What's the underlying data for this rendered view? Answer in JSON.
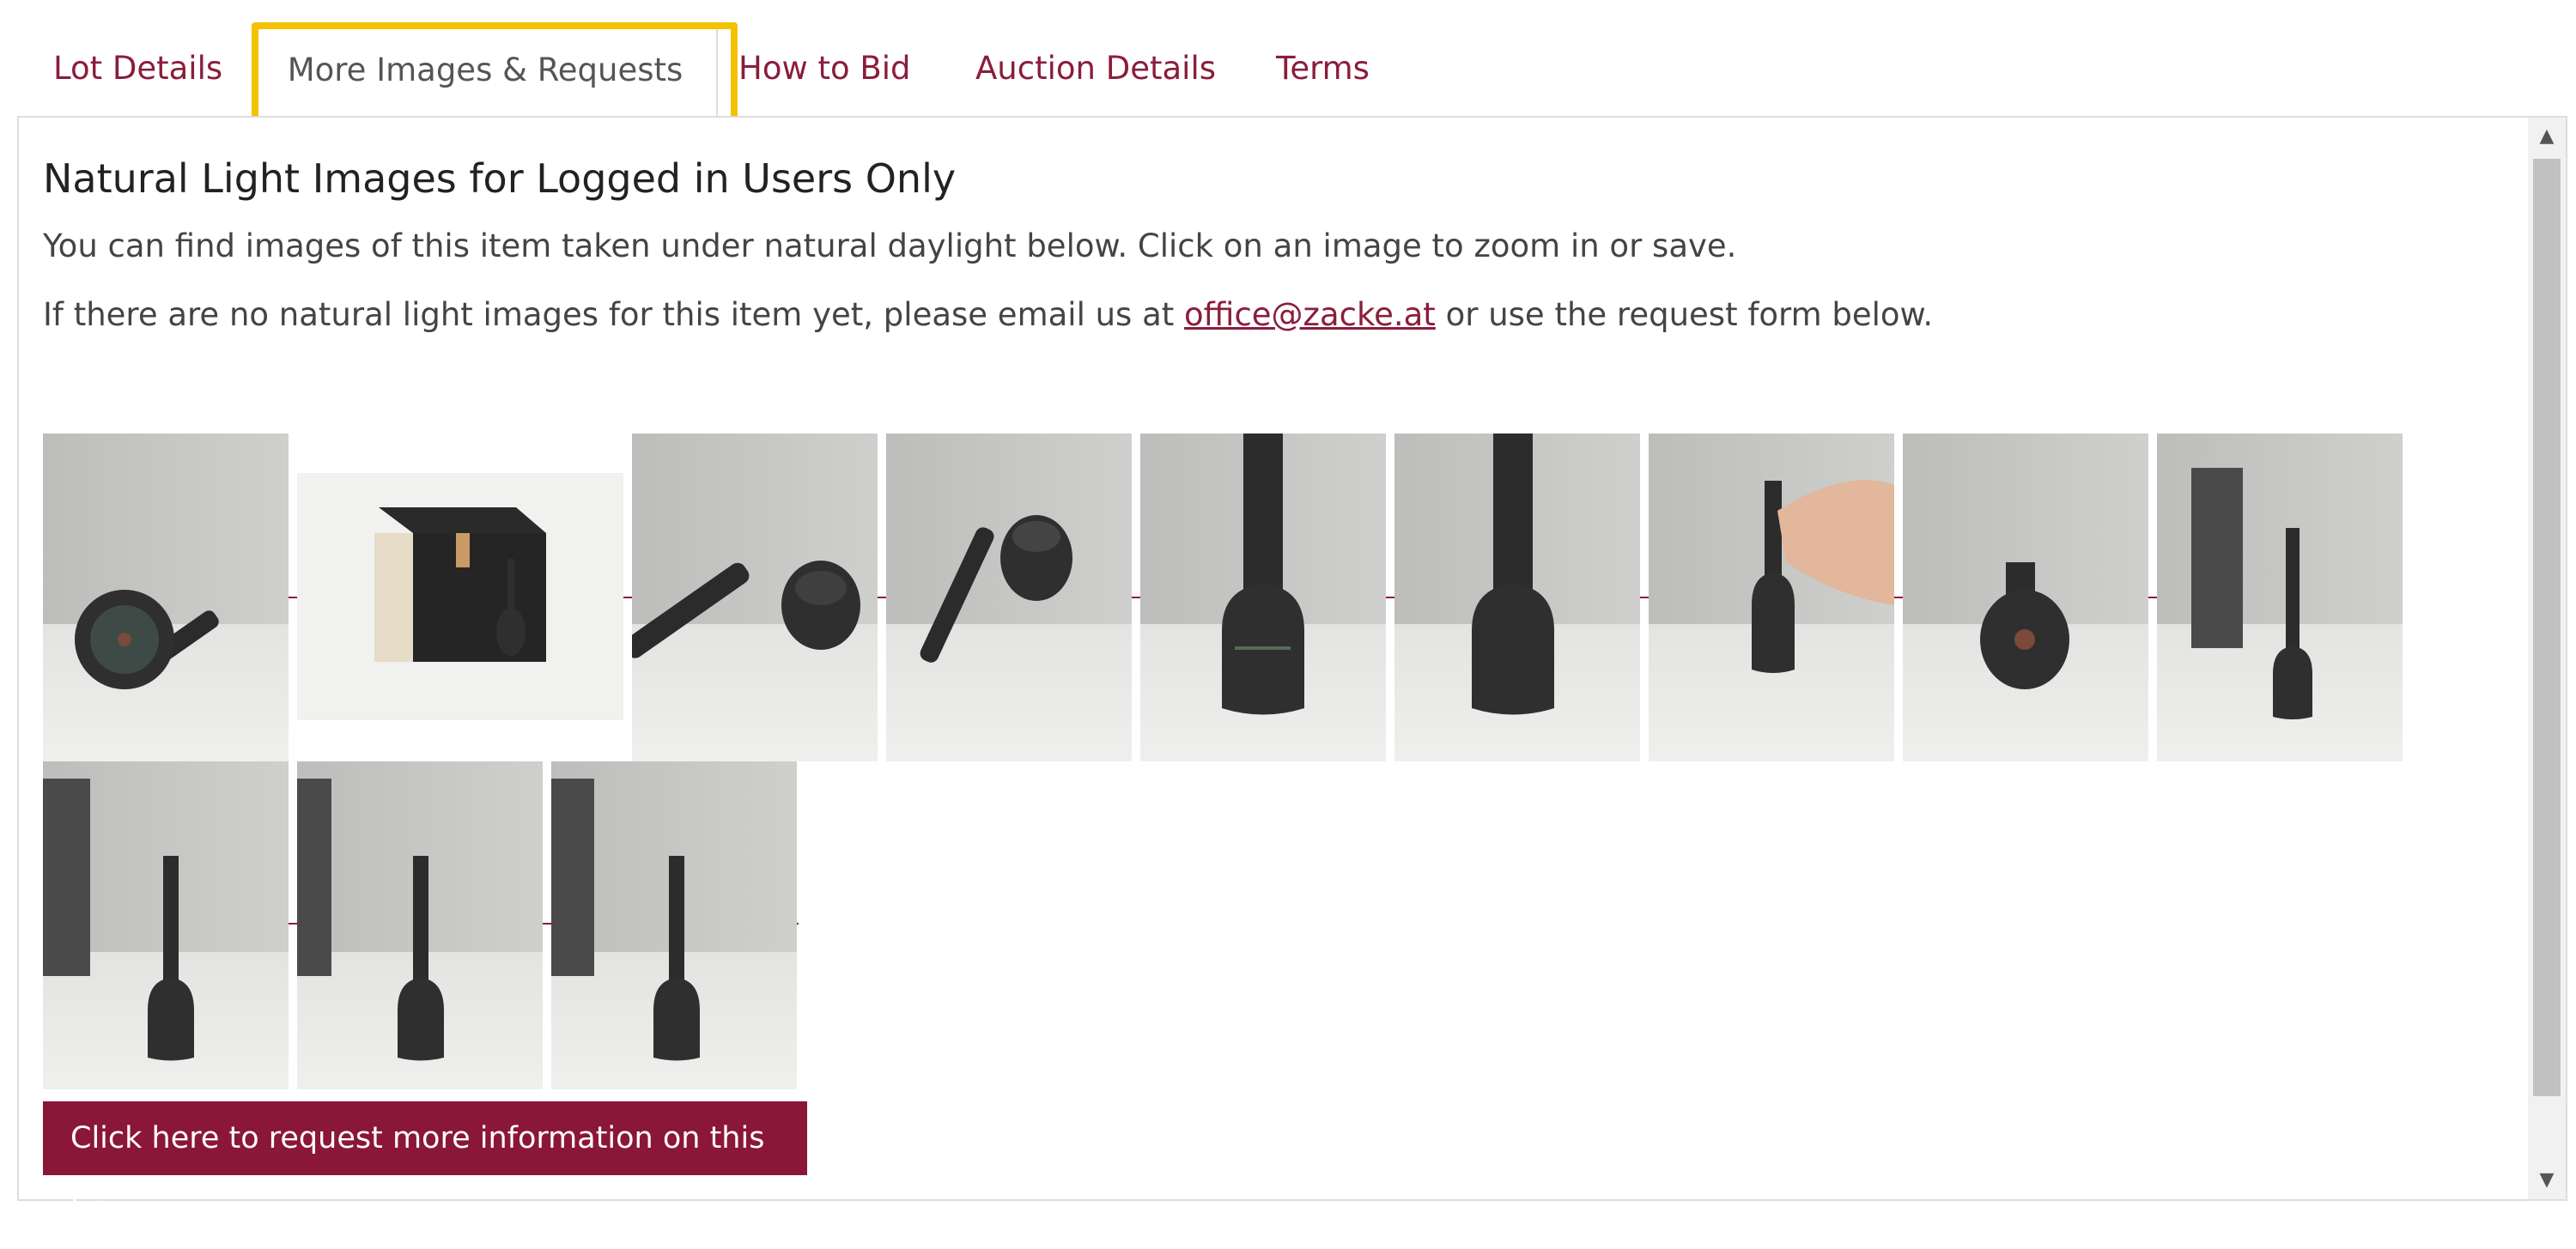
{
  "tabs": [
    {
      "label": "Lot Details",
      "active": false
    },
    {
      "label": "More Images & Requests",
      "active": true
    },
    {
      "label": "How to Bid",
      "active": false
    },
    {
      "label": "Auction Details",
      "active": false
    },
    {
      "label": "Terms",
      "active": false
    }
  ],
  "section": {
    "heading": "Natural Light Images for Logged in Users Only",
    "paragraph1": "You can find images of this item taken under natural daylight below. Click on an image to zoom in or save.",
    "paragraph2_before": "If there are no natural light images for this item yet, please email us at ",
    "email": "office@zacke.at",
    "paragraph2_after": " or use the request form below."
  },
  "images": [
    {
      "name": "vase-bottom-view"
    },
    {
      "name": "vase-with-box"
    },
    {
      "name": "vase-lying-angle"
    },
    {
      "name": "vase-neck-angle"
    },
    {
      "name": "vase-closeup-body"
    },
    {
      "name": "vase-closeup-body-2"
    },
    {
      "name": "vase-held-in-hand"
    },
    {
      "name": "vase-base-top-view"
    },
    {
      "name": "vase-standing-wide"
    },
    {
      "name": "vase-standing-front"
    },
    {
      "name": "vase-standing-side"
    },
    {
      "name": "vase-standing-back"
    }
  ],
  "request_button": {
    "label": "Click here to request more information on this lot."
  },
  "colors": {
    "accent": "#8a1638",
    "tab_text": "#8a1d3c",
    "highlight": "#f3c200"
  }
}
